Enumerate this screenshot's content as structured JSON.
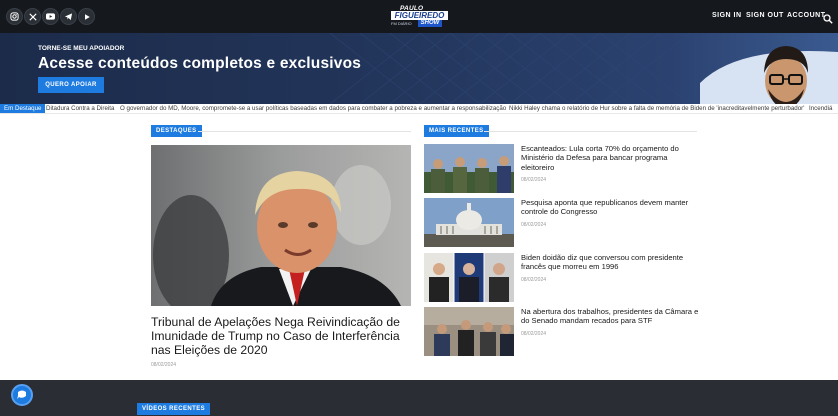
{
  "header": {
    "social": [
      "instagram-icon",
      "x-icon",
      "youtube-icon",
      "telegram-icon",
      "rumble-icon"
    ],
    "logo": {
      "line1": "PAULO",
      "line2": "FIGUEIREDO",
      "line3": "FM DIÁRIO",
      "line4": "SHOW"
    },
    "nav": {
      "sign_in": "SIGN IN",
      "sign_out": "SIGN OUT",
      "account": "ACCOUNT"
    },
    "search_icon": "search-icon"
  },
  "banner": {
    "kicker": "TORNE-SE MEU APOIADOR",
    "title": "Acesse conteúdos completos e exclusivos",
    "button": "QUERO APOIAR"
  },
  "ticker": {
    "label": "Em Destaque",
    "items": [
      "Ditadura Contra a Direita",
      "O governador do MD, Moore, compromete-se a usar políticas baseadas em dados para combater a pobreza e aumentar a responsabilização",
      "Nikki Haley chama o relatório de Hur sobre a falta de memória de Biden de 'inacreditavelmente perturbador'",
      "Incendiá"
    ]
  },
  "destaques": {
    "tag": "DESTAQUES",
    "title": "Tribunal de Apelações Nega Reivindicação de Imunidade de Trump no Caso de Interferência nas Eleições de 2020",
    "date": "08/02/2024"
  },
  "recentes": {
    "tag": "MAIS RECENTES",
    "items": [
      {
        "title": "Escanteados: Lula corta 70% do orçamento do Ministério da Defesa para bancar programa eleitoreiro",
        "date": "08/02/2024"
      },
      {
        "title": "Pesquisa aponta que republicanos devem manter controle do Congresso",
        "date": "08/02/2024"
      },
      {
        "title": "Biden doidão diz que conversou com presidente francês que morreu em 1996",
        "date": "08/02/2024"
      },
      {
        "title": "Na abertura dos trabalhos, presidentes da Câmara e do Senado mandam recados para STF",
        "date": "08/02/2024"
      }
    ]
  },
  "videos": {
    "tag": "VÍDEOS RECENTES"
  },
  "colors": {
    "accent": "#1e7be0",
    "topbar": "#15181d",
    "footer": "#2a2d33"
  }
}
